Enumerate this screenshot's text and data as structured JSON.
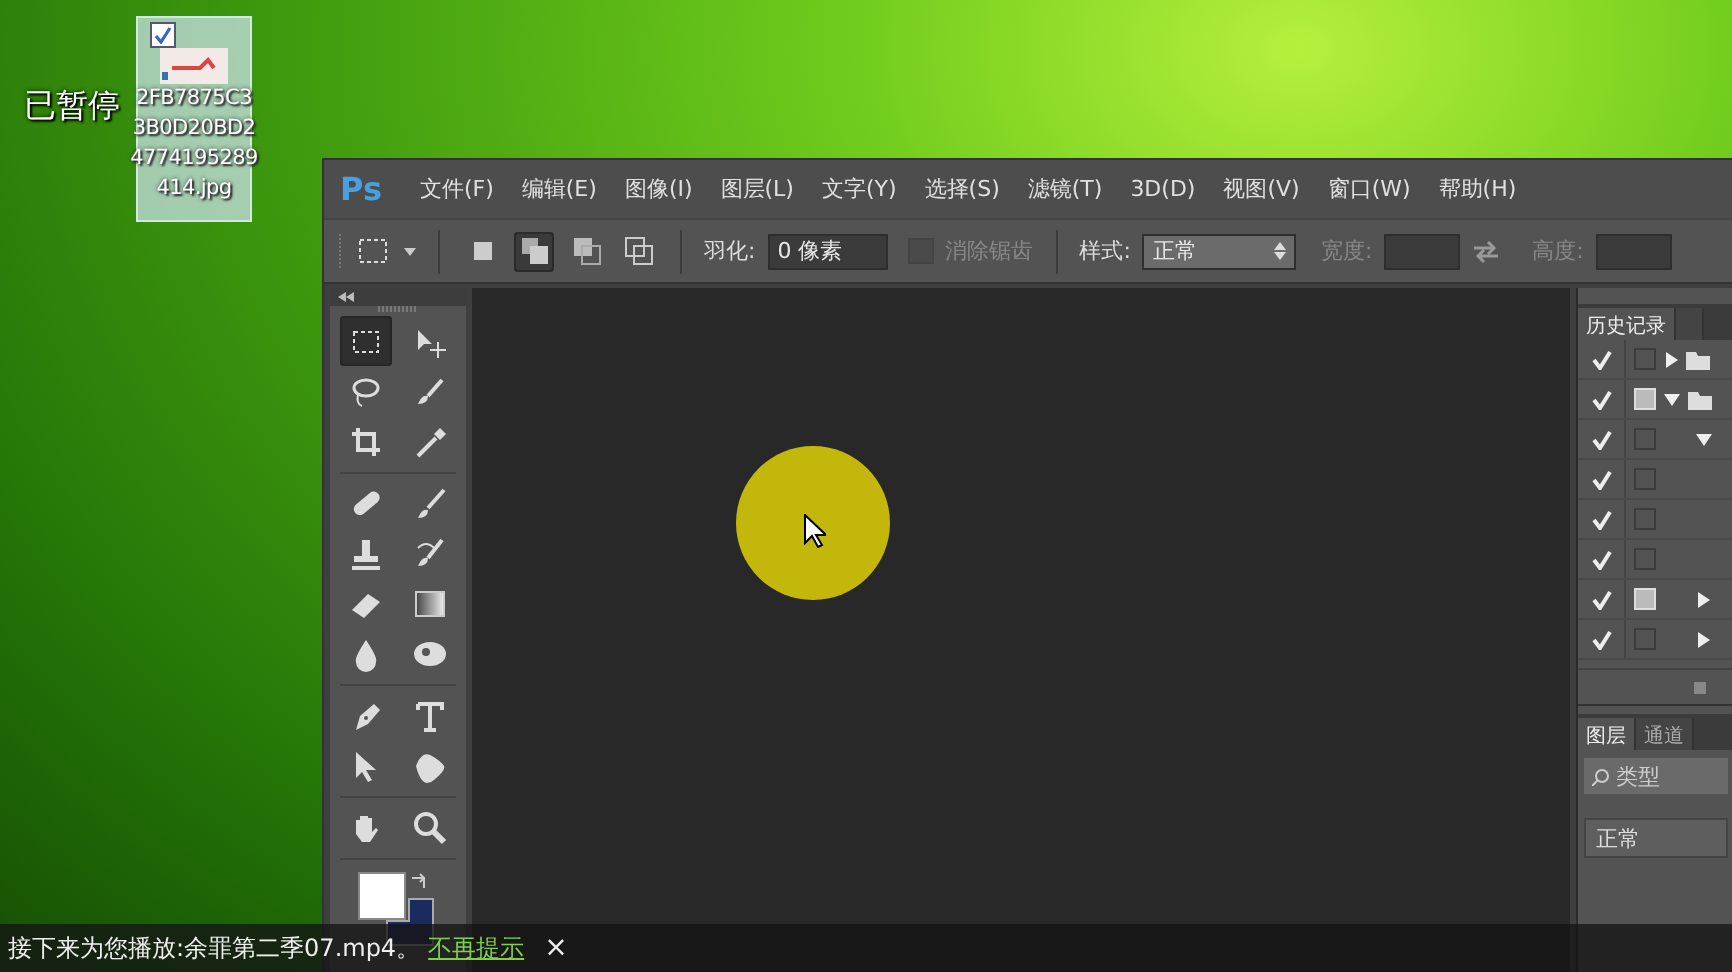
{
  "player": {
    "paused_label": "已暂停",
    "notice": {
      "text": "接下来为您播放:余罪第二季07.mp4。",
      "link": "不再提示",
      "close": "×"
    }
  },
  "desktop_icon": {
    "checked": true,
    "lines": [
      "2FB7875C3",
      "3B0D20BD2",
      "4774195289",
      "414.jpg"
    ]
  },
  "photoshop": {
    "logo": "Ps",
    "menu": [
      "文件(F)",
      "编辑(E)",
      "图像(I)",
      "图层(L)",
      "文字(Y)",
      "选择(S)",
      "滤镜(T)",
      "3D(D)",
      "视图(V)",
      "窗口(W)",
      "帮助(H)"
    ],
    "options": {
      "selection_modes": [
        {
          "selected": false
        },
        {
          "selected": true
        },
        {
          "selected": false
        },
        {
          "selected": false
        }
      ],
      "feather_label": "羽化:",
      "feather_value": "0 像素",
      "antialias": {
        "label": "消除锯齿",
        "checked": false,
        "disabled": true
      },
      "style_label": "样式:",
      "style_value": "正常",
      "width_label": "宽度:",
      "height_label": "高度:"
    },
    "tool_groups": [
      [
        {
          "selected": true
        },
        {
          "selected": false
        },
        {
          "selected": false
        },
        {
          "selected": false
        },
        {
          "selected": false
        },
        {
          "selected": false
        }
      ],
      [
        {
          "selected": false
        },
        {
          "selected": false
        },
        {
          "selected": false
        },
        {
          "selected": false
        },
        {
          "selected": false
        },
        {
          "selected": false
        },
        {
          "selected": false
        },
        {
          "selected": false
        }
      ],
      [
        {
          "selected": false
        },
        {
          "selected": false
        },
        {
          "selected": false
        },
        {
          "selected": false
        }
      ],
      [
        {
          "selected": false
        },
        {
          "selected": false
        }
      ]
    ],
    "history": {
      "tab": "历史记录",
      "rows": [
        {
          "kind": "folder",
          "visible": true,
          "thumbnail": false,
          "expanded": false
        },
        {
          "kind": "folder",
          "visible": true,
          "thumbnail": true,
          "expanded": true
        },
        {
          "kind": "group",
          "visible": true,
          "thumbnail": false,
          "expanded": true
        },
        {
          "kind": "item",
          "visible": true,
          "thumbnail": false
        },
        {
          "kind": "item",
          "visible": true,
          "thumbnail": false
        },
        {
          "kind": "item",
          "visible": true,
          "thumbnail": false
        },
        {
          "kind": "group",
          "visible": true,
          "thumbnail": true,
          "expanded": false
        },
        {
          "kind": "group",
          "visible": true,
          "thumbnail": false,
          "expanded": false
        }
      ]
    },
    "layers": {
      "tabs": [
        {
          "label": "图层",
          "selected": true
        },
        {
          "label": "通道",
          "selected": false
        }
      ],
      "search_placeholder": "类型",
      "blend_mode": "正常"
    }
  }
}
